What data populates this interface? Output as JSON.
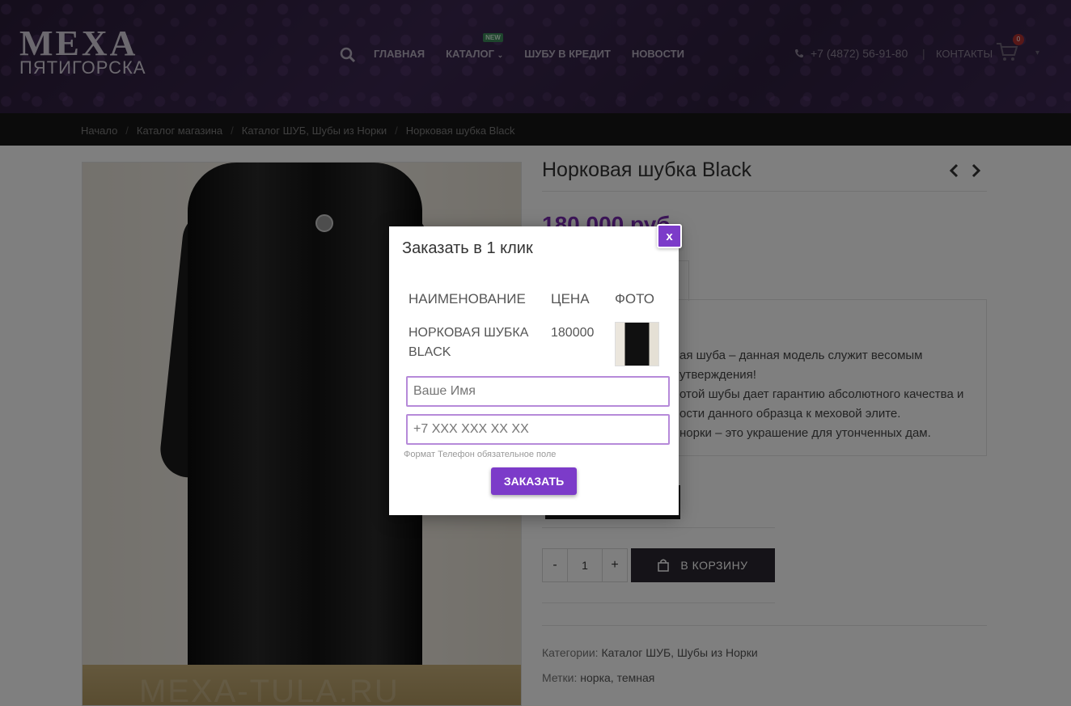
{
  "header": {
    "logo_line1": "МЕХА",
    "logo_line2": "ПЯТИГОРСКА",
    "nav": {
      "home": "ГЛАВНАЯ",
      "catalog": "КАТАЛОГ",
      "catalog_badge": "NEW",
      "credit": "ШУБУ В КРЕДИТ",
      "news": "НОВОСТИ"
    },
    "phone": "+7 (4872) 56-91-80",
    "separator": "|",
    "contacts": "КОНТАКТЫ",
    "cart_count": "0"
  },
  "breadcrumbs": [
    "Начало",
    "Каталог магазина",
    "Каталог ШУБ,  Шубы из Норки",
    "Норковая шубка Black"
  ],
  "product": {
    "title": "Норковая шубка Black",
    "price": "180 000 руб",
    "description_lines": [
      "ая шуба – данная модель служит весомым",
      "утверждения!",
      "отой шубы дает гарантию абсолютного качества и",
      "ости данного образца к меховой элите.",
      " норки – это украшение для утонченных дам."
    ],
    "quantity": "1",
    "qty_minus": "-",
    "qty_plus": "+",
    "add_to_cart": "В КОРЗИНУ",
    "categories_label": "Категории:",
    "categories_value": "Каталог ШУБ, Шубы из Норки",
    "tags_label": "Метки:",
    "tags_value": "норка, темная",
    "watermark": "MEXA-TULA.RU"
  },
  "modal": {
    "title": "Заказать в 1 клик",
    "close_label": "x",
    "columns": [
      "НАИМЕНОВАНИЕ",
      "ЦЕНА",
      "ФОТО"
    ],
    "item_name_line1": "НОРКОВАЯ ШУБКА",
    "item_name_line2": "BLACK",
    "item_price": "180000",
    "name_placeholder": "Ваше Имя",
    "phone_placeholder": "+7 XXX XXX XX XX",
    "hint": "Формат Телефон обязательное поле",
    "submit_label": "ЗАКАЗАТЬ"
  },
  "colors": {
    "accent": "#7c3bc9",
    "price": "#7a2bb2",
    "header_bg": "#2a1c38",
    "field_border": "#b68ad9"
  }
}
